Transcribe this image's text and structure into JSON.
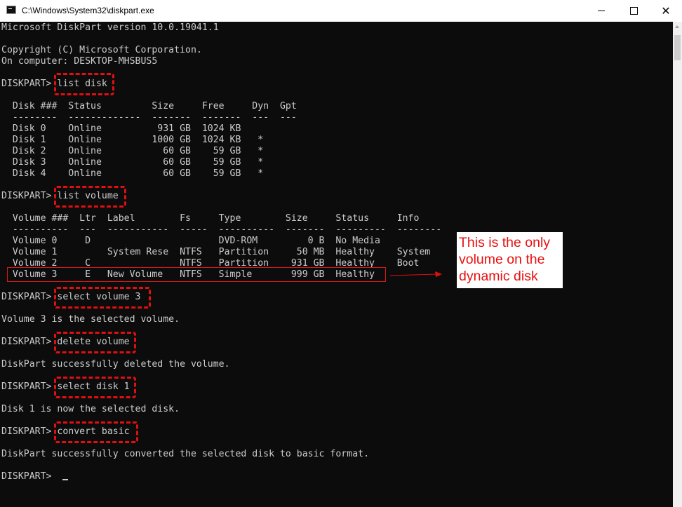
{
  "window": {
    "title": "C:\\Windows\\System32\\diskpart.exe",
    "minimize": "minimize",
    "maximize": "maximize",
    "close": "✕"
  },
  "console": {
    "lines": [
      "Microsoft DiskPart version 10.0.19041.1",
      "",
      "Copyright (C) Microsoft Corporation.",
      "On computer: DESKTOP-MHSBUS5",
      "",
      "DISKPART> list disk",
      "",
      "  Disk ###  Status         Size     Free     Dyn  Gpt",
      "  --------  -------------  -------  -------  ---  ---",
      "  Disk 0    Online          931 GB  1024 KB",
      "  Disk 1    Online         1000 GB  1024 KB   *",
      "  Disk 2    Online           60 GB    59 GB   *",
      "  Disk 3    Online           60 GB    59 GB   *",
      "  Disk 4    Online           60 GB    59 GB   *",
      "",
      "DISKPART> list volume",
      "",
      "  Volume ###  Ltr  Label        Fs     Type        Size     Status     Info",
      "  ----------  ---  -----------  -----  ----------  -------  ---------  --------",
      "  Volume 0     D                       DVD-ROM         0 B  No Media",
      "  Volume 1         System Rese  NTFS   Partition     50 MB  Healthy    System",
      "  Volume 2     C                NTFS   Partition    931 GB  Healthy    Boot",
      "  Volume 3     E   New Volume   NTFS   Simple       999 GB  Healthy",
      "",
      "DISKPART> select volume 3",
      "",
      "Volume 3 is the selected volume.",
      "",
      "DISKPART> delete volume",
      "",
      "DiskPart successfully deleted the volume.",
      "",
      "DISKPART> select disk 1",
      "",
      "Disk 1 is now the selected disk.",
      "",
      "DISKPART> convert basic",
      "",
      "DiskPart successfully converted the selected disk to basic format.",
      "",
      "DISKPART> "
    ]
  },
  "annotation": {
    "callout_lines": [
      "This is the only",
      "volume on the",
      "dynamic disk"
    ],
    "color": "#e01010"
  }
}
